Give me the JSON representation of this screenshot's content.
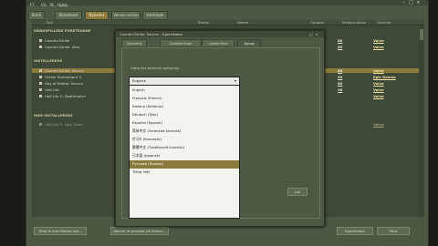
{
  "window": {
    "menu": [
      "F?",
      "Vis",
      "?lk",
      "Hjælp"
    ],
    "tabs": [
      "Butik",
      "Biblioteket",
      "Nyheder",
      "Venner online",
      "Værktøjer"
    ],
    "active_tab_index": 2
  },
  "columns": [
    "Spil",
    "Status",
    "Næste",
    "Opdater",
    "Metapunktaal",
    "Udvikler"
  ],
  "categories": [
    {
      "label": "HÅNDSPILLEDE FORETRUKNE",
      "rows": [
        {
          "name": "Counter-Strike",
          "v1": "88",
          "v2": "Valve"
        },
        {
          "name": "Counter-Strike: Zero",
          "v1": "65",
          "v2": "Valve"
        }
      ]
    },
    {
      "label": "INSTALLEREDE",
      "rows": [
        {
          "name": "Counter-Strike: Source",
          "v1": "88",
          "v2": "Valve",
          "selected": true
        },
        {
          "name": "Unreal Tournament 3",
          "v1": "90",
          "v2": "Epic Games"
        },
        {
          "name": "Day of Defeat: Source",
          "v1": "80",
          "v2": "Valve"
        },
        {
          "name": "Half-Life",
          "v1": "96",
          "v2": "Valve"
        },
        {
          "name": "Half-Life 2: Deathmatch",
          "v1": "",
          "v2": "Valve"
        }
      ]
    },
    {
      "label": "IKKE-INSTALLEREDE",
      "rows": [
        {
          "name": "Half-Life 2: Lost Coast",
          "v1": "",
          "v2": "Valve",
          "dim": true
        }
      ]
    }
  ],
  "bottom_buttons": {
    "left1": "Tilføj et ikke-Steam-spil...",
    "left2": "Aktiver et produkt på Steam...",
    "right1": "Egenskaber",
    "right2": "Start"
  },
  "dialog": {
    "title": "Counter-Strike: Source – Egenskaber",
    "close": "x",
    "tabs": [
      "Generelt",
      "Opdateringer",
      "Lokale filer",
      "Sprog"
    ],
    "active_tab_index": 3,
    "prompt": "Vælg det ønskede spilsprog:",
    "selected_value": "Engelsk",
    "options": [
      "English",
      "Français (French)",
      "Italiano (Italiensk)",
      "Deutsch (Tysk)",
      "Español (Spansk)",
      "简体中文 (Forenklet kinesisk)",
      "한국어 (Koreansk)",
      "繁體中文 (Traditionelt kinesisk)",
      "日本語 (Japansk)",
      "Русский (Russisk)",
      "Tiếng Việt"
    ],
    "highlight_index": 9,
    "luk_label": "Luk"
  },
  "colors": {
    "accent": "#8a7a3c",
    "window_bg": "#4c5844"
  }
}
